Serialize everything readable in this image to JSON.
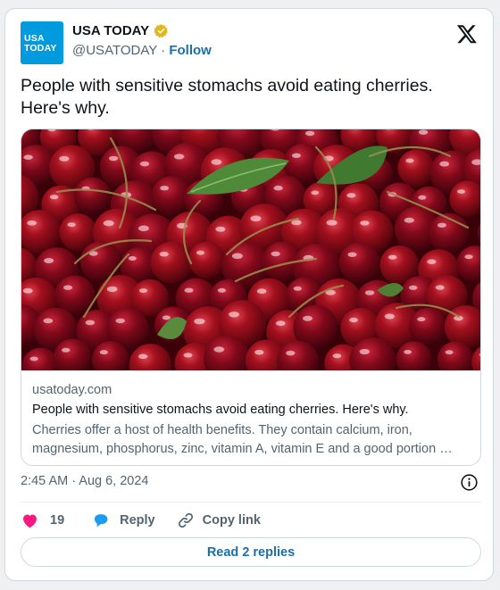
{
  "account": {
    "logo_line1": "USA",
    "logo_line2": "TODAY",
    "display_name": "USA TODAY",
    "verified_badge": "gold-verified-icon",
    "handle": "@USATODAY",
    "separator": "·",
    "follow_label": "Follow"
  },
  "tweet": {
    "text": "People with sensitive stomachs avoid eating cherries. Here's why.",
    "timestamp": "2:45 AM · Aug 6, 2024"
  },
  "link_card": {
    "image": "cherries-photo",
    "domain": "usatoday.com",
    "title": "People with sensitive stomachs avoid eating cherries. Here's why.",
    "description": "Cherries offer a host of health benefits. They contain calcium, iron, magnesium, phosphorus, zinc, vitamin A, vitamin E and a good portion …"
  },
  "actions": {
    "like_count": "19",
    "reply_label": "Reply",
    "copy_link_label": "Copy link",
    "read_replies_label": "Read 2 replies"
  },
  "icons": {
    "platform": "x-logo-icon",
    "info": "info-icon",
    "like": "heart-icon",
    "reply": "speech-bubble-icon",
    "copy": "link-icon"
  },
  "colors": {
    "logo_blue": "#009bde",
    "follow_blue": "#1d6fa5",
    "like_pink": "#f91880",
    "reply_blue": "#1d9bf0",
    "verified_gold": "#e2b719",
    "muted_text": "#536471",
    "border": "#cfd9de"
  }
}
